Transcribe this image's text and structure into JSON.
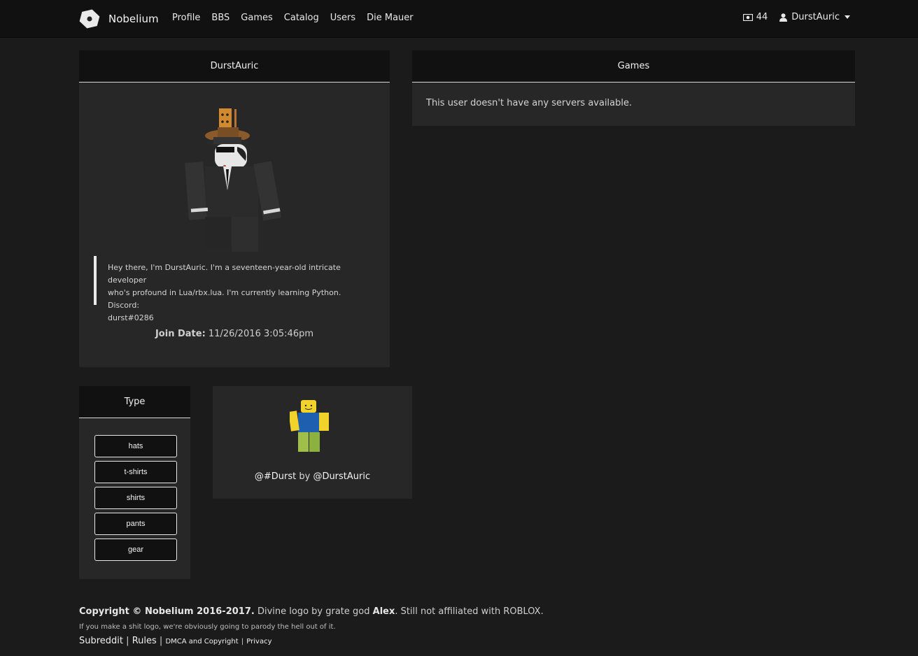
{
  "navbar": {
    "brand": "Nobelium",
    "links": [
      "Profile",
      "BBS",
      "Games",
      "Catalog",
      "Users",
      "Die Mauer"
    ],
    "currency": "44",
    "username": "DurstAuric"
  },
  "profile": {
    "title": "DurstAuric",
    "bio_lines": [
      "Hey there, I'm DurstAuric. I'm a seventeen-year-old intricate developer",
      "who's profound in Lua/rbx.lua. I'm currently learning Python. Discord:",
      "durst#0286"
    ],
    "join_label": "Join Date:",
    "join_value": "11/26/2016 3:05:46pm"
  },
  "games": {
    "title": "Games",
    "empty_text": "This user doesn't have any servers available."
  },
  "type_filter": {
    "title": "Type",
    "options": [
      "hats",
      "t-shirts",
      "shirts",
      "pants",
      "gear"
    ]
  },
  "item": {
    "name": "@#Durst",
    "by": "by",
    "creator": "@DurstAuric"
  },
  "footer": {
    "copyright": "Copyright © Nobelium 2016-2017.",
    "logo_credit_prefix": "Divine logo by grate god",
    "logo_credit_name": "Alex",
    "affiliation": "Still not affiliated with ROBLOX.",
    "parody_note": "If you make a shit logo, we're obviously going to parody the hell out of it.",
    "links": [
      "Subreddit",
      "Rules",
      "DMCA and Copyright",
      "Privacy"
    ],
    "separator": "|"
  }
}
